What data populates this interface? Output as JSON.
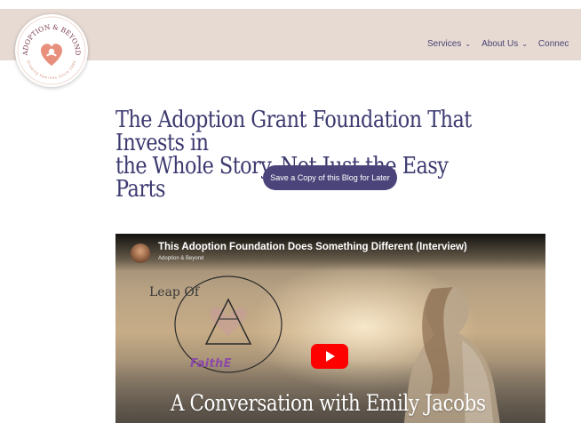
{
  "logo": {
    "top_text": "ADOPTION & BEYOND",
    "bottom_text": "Growing Families Since 1995"
  },
  "nav": {
    "items": [
      {
        "label": "Services",
        "icon": "chevron-down-icon"
      },
      {
        "label": "About Us",
        "icon": "chevron-down-icon"
      },
      {
        "label": "Connec"
      }
    ]
  },
  "page": {
    "title_line1": "The Adoption Grant Foundation That Invests in",
    "title_line2": "the Whole Story, Not Just the Easy Parts",
    "save_button": "Save a Copy of this Blog for Later"
  },
  "video": {
    "title": "This Adoption Foundation Does Something Different (Interview)",
    "channel": "Adoption & Beyond",
    "logo_top": "Leap Of",
    "logo_bottom": "FaithE",
    "caption": "A Conversation with Emily Jacobs",
    "play_icon": "play-icon"
  },
  "colors": {
    "header_bg": "#e6dad3",
    "brand_purple": "#4b447a",
    "heading": "#3c3a70",
    "play_red": "#ff0000"
  }
}
